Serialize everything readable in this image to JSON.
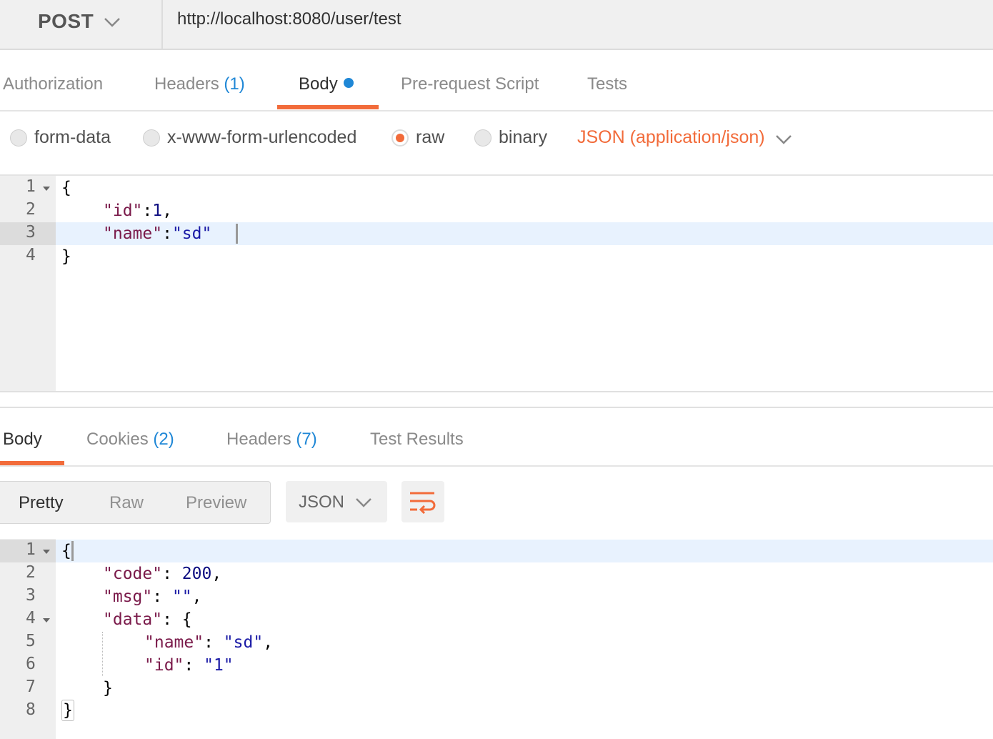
{
  "request": {
    "method": "POST",
    "url": "http://localhost:8080/user/test"
  },
  "request_tabs": [
    {
      "label": "Authorization",
      "count": ""
    },
    {
      "label": "Headers",
      "count": "(1)"
    },
    {
      "label": "Body",
      "count": "",
      "active": true
    },
    {
      "label": "Pre-request Script",
      "count": ""
    },
    {
      "label": "Tests",
      "count": ""
    }
  ],
  "body_types": [
    {
      "label": "form-data",
      "selected": false
    },
    {
      "label": "x-www-form-urlencoded",
      "selected": false
    },
    {
      "label": "raw",
      "selected": true
    },
    {
      "label": "binary",
      "selected": false
    }
  ],
  "content_type": "JSON (application/json)",
  "request_editor": {
    "line_numbers": [
      "1",
      "2",
      "3",
      "4"
    ],
    "lines": [
      {
        "brace": "{"
      },
      {
        "key": "\"id\"",
        "sep": ":",
        "val": "1",
        "tail": ","
      },
      {
        "key": "\"name\"",
        "sep": ":",
        "val": "\"sd\""
      },
      {
        "brace": "}"
      }
    ]
  },
  "response_tabs": [
    {
      "label": "Body",
      "count": "",
      "active": true
    },
    {
      "label": "Cookies",
      "count": "(2)"
    },
    {
      "label": "Headers",
      "count": "(7)"
    },
    {
      "label": "Test Results",
      "count": ""
    }
  ],
  "view_modes": {
    "pretty": "Pretty",
    "raw": "Raw",
    "preview": "Preview"
  },
  "response_format": "JSON",
  "response_editor": {
    "line_numbers": [
      "1",
      "2",
      "3",
      "4",
      "5",
      "6",
      "7",
      "8"
    ],
    "lines": [
      {
        "brace": "{"
      },
      {
        "key": "\"code\"",
        "sep": ": ",
        "val": "200",
        "tail": ","
      },
      {
        "key": "\"msg\"",
        "sep": ": ",
        "val": "\"\"",
        "tail": ","
      },
      {
        "key": "\"data\"",
        "sep": ": ",
        "val": "{"
      },
      {
        "key": "\"name\"",
        "sep": ": ",
        "val": "\"sd\"",
        "tail": ","
      },
      {
        "key": "\"id\"",
        "sep": ": ",
        "val": "\"1\""
      },
      {
        "brace": "}"
      },
      {
        "brace": "}"
      }
    ]
  },
  "colors": {
    "accent": "#f26b3a",
    "link_blue": "#1f87d6",
    "json_key": "#7a1a4a",
    "json_string": "#1a1aa6"
  }
}
